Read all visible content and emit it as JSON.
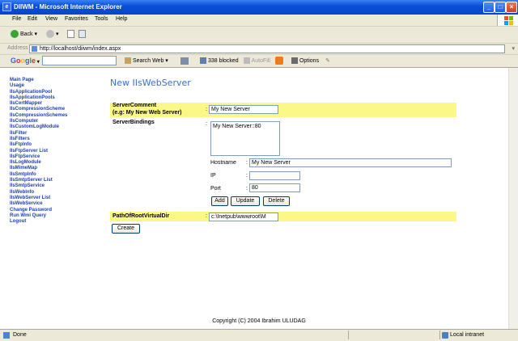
{
  "window": {
    "title": "DIIWM - Microsoft Internet Explorer"
  },
  "menu": [
    "File",
    "Edit",
    "View",
    "Favorites",
    "Tools",
    "Help"
  ],
  "toolbar": {
    "back_label": "Back"
  },
  "address": {
    "label": "Address",
    "url": "http://localhost/diiwm/index.aspx"
  },
  "google_bar": {
    "logo": "Google",
    "search_web": "Search Web",
    "blocked": "338 blocked",
    "autofill": "AutoFill",
    "options": "Options"
  },
  "nav_links": [
    "Main Page",
    "Usage",
    "IIsApplicationPool",
    "IIsApplicationPools",
    "IIsCertMapper",
    "IIsCompressionScheme",
    "IIsCompressionSchemes",
    "IIsComputer",
    "IIsCustomLogModule",
    "IIsFilter",
    "IIsFilters",
    "IIsFtpInfo",
    "IIsFtpServer List",
    "IIsFtpService",
    "IIsLogModule",
    "IIsMimeMap",
    "IIsSmtpInfo",
    "IIsSmtpServer List",
    "IIsSmtpService",
    "IIsWebInfo",
    "IIsWebServer List",
    "IIsWebService",
    "Change Password",
    "Run Wmi Query",
    "Logout"
  ],
  "form": {
    "heading": "New IIsWebServer",
    "server_comment_label": "ServerComment",
    "server_comment_hint": "(e.g: My New Web Server)",
    "server_comment_value": "My New Server",
    "server_bindings_label": "ServerBindings",
    "bindings_list": [
      "My New Server::80"
    ],
    "hostname_label": "Hostname",
    "hostname_value": "My New Server",
    "ip_label": "IP",
    "ip_value": "",
    "port_label": "Port",
    "port_value": "80",
    "add_label": "Add",
    "update_label": "Update",
    "delete_label": "Delete",
    "path_label": "PathOfRootVirtualDir",
    "path_value": "c:\\Inetpub\\wwwroot\\M",
    "create_label": "Create",
    "colon": ":"
  },
  "footer": {
    "copyright": "Copyright (C) 2004 Ibrahim ULUDAG"
  },
  "status": {
    "text": "Done",
    "zone": "Local intranet"
  }
}
